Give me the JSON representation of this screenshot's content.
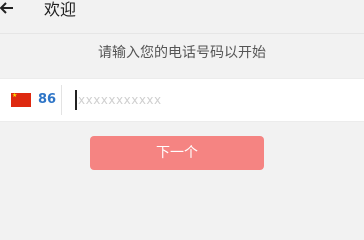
{
  "header": {
    "title": "欢迎",
    "back_icon": "arrow-left-icon"
  },
  "prompt": "请输入您的电话号码以开始",
  "phone": {
    "country_flag": "china-flag-icon",
    "country_code": "86",
    "placeholder": "xxxxxxxxxxx",
    "value": ""
  },
  "next_button": {
    "label": "下一个"
  },
  "colors": {
    "background": "#f2f2f2",
    "button": "#f58482",
    "country_code": "#2e75c7"
  }
}
